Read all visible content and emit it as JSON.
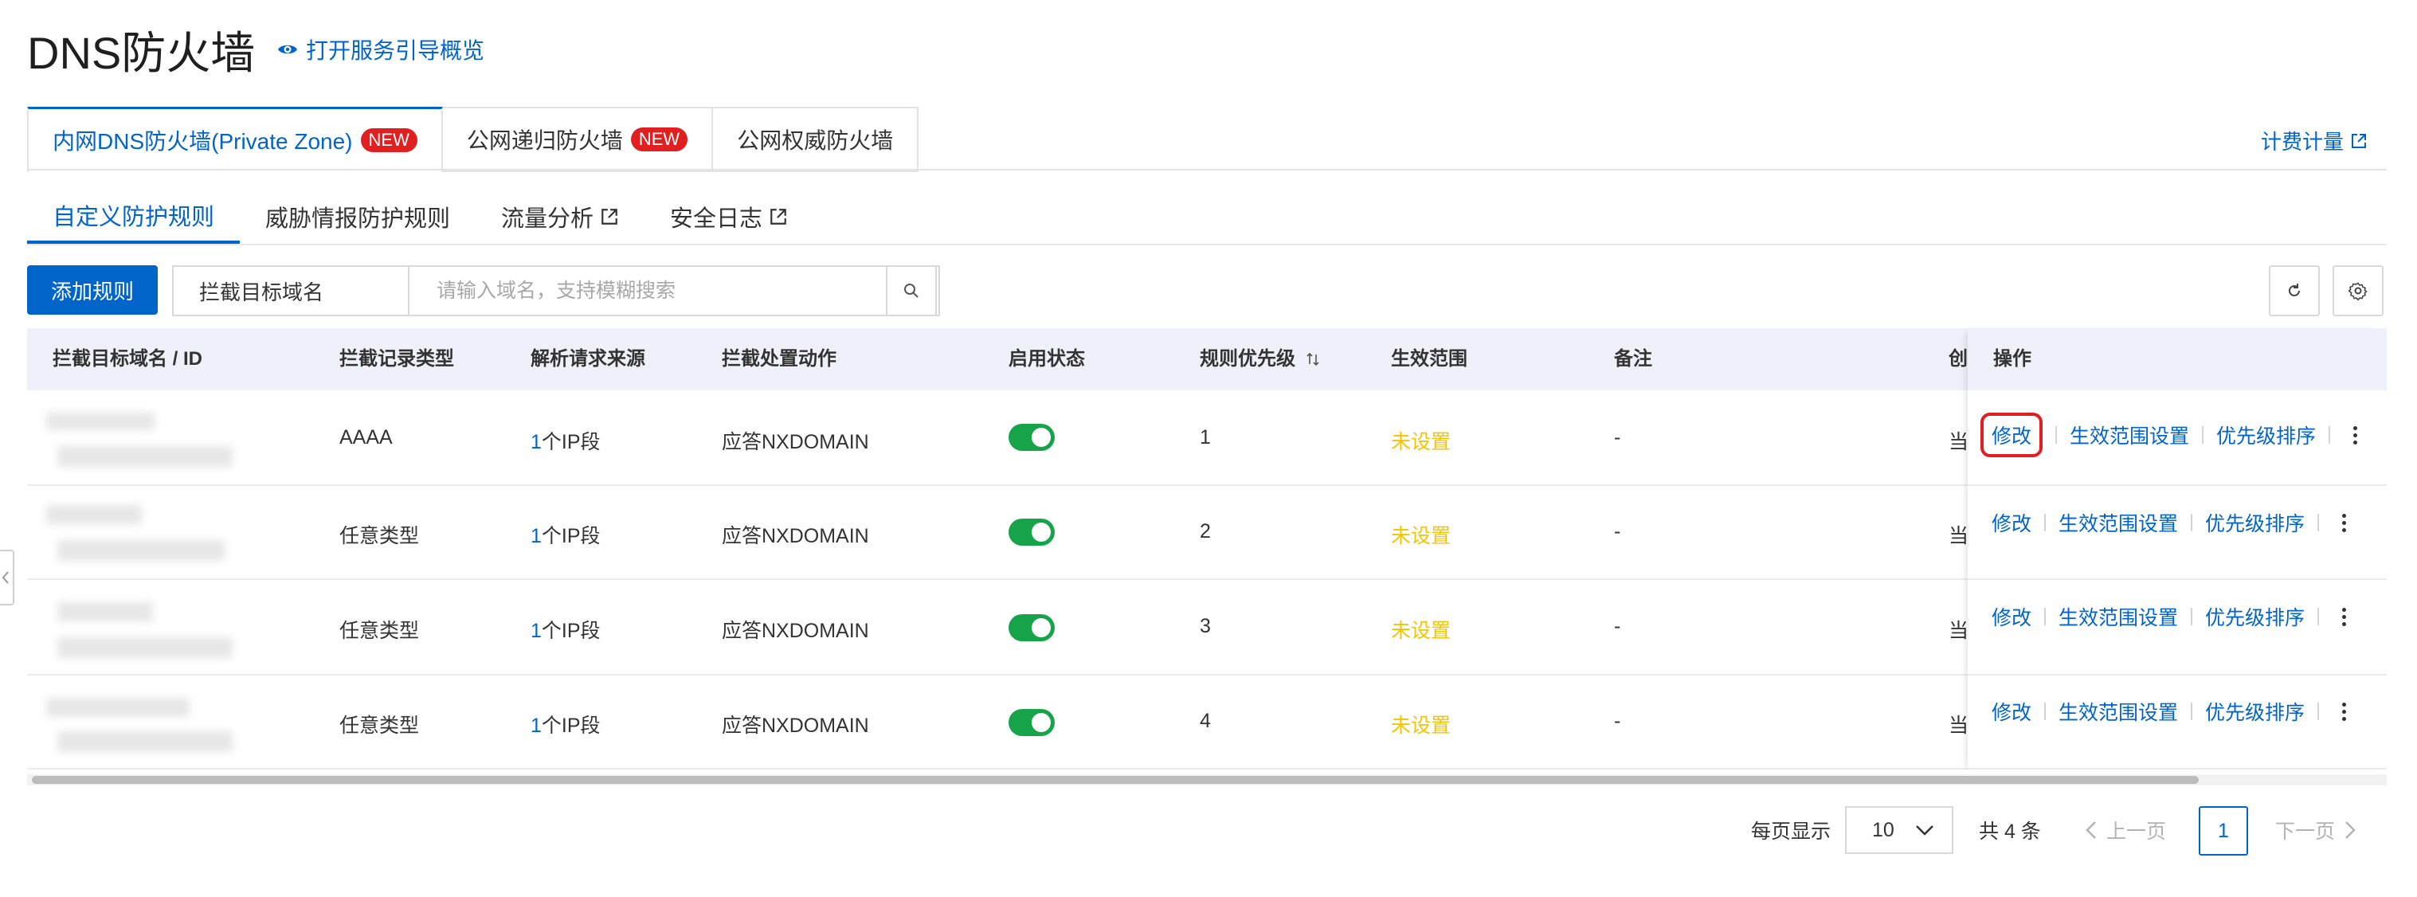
{
  "header": {
    "title": "DNS防火墙",
    "guide_link": "打开服务引导概览"
  },
  "tabs": [
    {
      "label": "内网DNS防火墙(Private Zone)",
      "badge": "NEW",
      "active": true
    },
    {
      "label": "公网递归防火墙",
      "badge": "NEW",
      "active": false
    },
    {
      "label": "公网权威防火墙",
      "badge": "",
      "active": false
    }
  ],
  "billing_link": "计费计量",
  "subtabs": [
    {
      "label": "自定义防护规则",
      "external": false,
      "active": true
    },
    {
      "label": "威胁情报防护规则",
      "external": false,
      "active": false
    },
    {
      "label": "流量分析",
      "external": true,
      "active": false
    },
    {
      "label": "安全日志",
      "external": true,
      "active": false
    }
  ],
  "toolbar": {
    "add_button": "添加规则",
    "filter_select": "拦截目标域名",
    "search_placeholder": "请输入域名，支持模糊搜索"
  },
  "table": {
    "columns": [
      "拦截目标域名 / ID",
      "拦截记录类型",
      "解析请求来源",
      "拦截处置动作",
      "启用状态",
      "规则优先级",
      "生效范围",
      "备注",
      "创",
      "操作"
    ],
    "rows": [
      {
        "record_type": "AAAA",
        "source_count": "1",
        "source_unit": "个IP段",
        "action": "应答NXDOMAIN",
        "enabled": true,
        "priority": "1",
        "scope": "未设置",
        "remark": "-",
        "created": "当"
      },
      {
        "record_type": "任意类型",
        "source_count": "1",
        "source_unit": "个IP段",
        "action": "应答NXDOMAIN",
        "enabled": true,
        "priority": "2",
        "scope": "未设置",
        "remark": "-",
        "created": "当"
      },
      {
        "record_type": "任意类型",
        "source_count": "1",
        "source_unit": "个IP段",
        "action": "应答NXDOMAIN",
        "enabled": true,
        "priority": "3",
        "scope": "未设置",
        "remark": "-",
        "created": "当"
      },
      {
        "record_type": "任意类型",
        "source_count": "1",
        "source_unit": "个IP段",
        "action": "应答NXDOMAIN",
        "enabled": true,
        "priority": "4",
        "scope": "未设置",
        "remark": "-",
        "created": "当"
      }
    ],
    "actions": {
      "edit": "修改",
      "scope_setting": "生效范围设置",
      "priority_sort": "优先级排序"
    }
  },
  "pagination": {
    "per_page_label": "每页显示",
    "per_page": "10",
    "total": "共 4 条",
    "prev": "上一页",
    "current": "1",
    "next": "下一页"
  },
  "colors": {
    "accent": "#0064c8",
    "toggle_on": "#17a34a",
    "scope_unset": "#f5c400",
    "badge": "#e02020",
    "highlight": "#e02020"
  }
}
